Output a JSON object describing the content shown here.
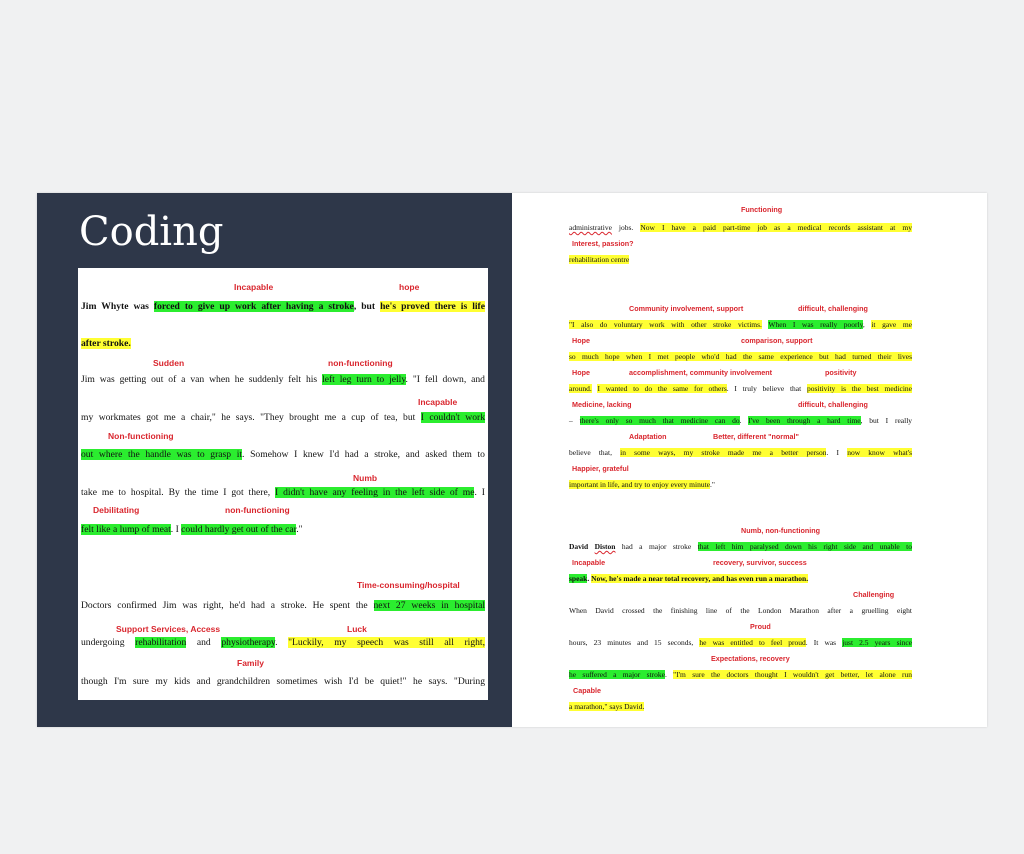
{
  "title": "Coding",
  "doc1": {
    "labels": [
      "Incapable",
      "hope",
      "Sudden",
      "non-functioning",
      "Incapable",
      "Non-functioning",
      "Numb",
      "Debilitating",
      "non-functioning",
      "Time-consuming/hospital",
      "Support Services, Access",
      "Luck",
      "Family"
    ],
    "seg": [
      "Jim Whyte was ",
      "forced to give up work after having a stroke",
      ", but ",
      "he's proved there is life",
      "after stroke.",
      "Jim was getting out of a van when he suddenly felt his ",
      "left leg turn to jelly",
      ". \"I fell down, and",
      "my workmates got me a chair,\" he says. \"They brought me a cup of tea, but ",
      "I couldn't work",
      "out where the handle was to grasp it",
      ". Somehow I knew I'd had a stroke, and asked them to",
      "take me to hospital. By the time I got there, ",
      "I didn't have any feeling in the left side of me",
      ". I",
      "felt like a lump of meat",
      ". I ",
      "could hardly get out of the car",
      ".\"",
      "Doctors confirmed Jim was right, he'd had a stroke. He spent the ",
      "next 27 weeks in hospital",
      "undergoing ",
      "rehabilitation",
      " and ",
      "physiotherapy",
      ". ",
      "\"Luckily, my speech was still all right,",
      "though I'm sure my kids and grandchildren sometimes wish I'd be quiet!\" he says. \"During"
    ]
  },
  "doc2": {
    "labels": [
      "Functioning",
      "Interest, passion?",
      "Community involvement, support",
      "difficult, challenging",
      "Hope",
      "comparison, support",
      "Hope",
      "accomplishment, community involvement",
      "positivity",
      "Medicine, lacking",
      "difficult, challenging",
      "Adaptation",
      "Better, different \"normal\"",
      "Happier, grateful",
      "Numb, non-functioning",
      "Incapable",
      "recovery, survivor, success",
      "Challenging",
      "Proud",
      "Expectations, recovery",
      "Capable"
    ],
    "seg": [
      "administrative",
      " jobs. ",
      "Now I have a paid part-time job as a medical records assistant at my",
      "rehabilitation centre",
      "\"I also do voluntary work with other stroke victims.",
      " ",
      "When I was really poorly",
      ", ",
      "it gave me",
      "so much hope when I met people who'd had the same experience but had turned their lives",
      "around.",
      " ",
      "I wanted to do the same for others",
      ". I truly believe that ",
      "positivity is the best medicine",
      "– ",
      "there's only so much that medicine can do",
      ". ",
      "I've been through a hard time",
      ", but I really",
      "believe that, ",
      "in some ways, my stroke made me a better person",
      ". I ",
      "now know what's",
      "important in life, and try to enjoy every minute",
      ".\"",
      "David ",
      "Diston",
      " had a major stroke ",
      "that left him paralysed down his right side and unable to",
      "speak",
      ". ",
      "Now, he's made a near total recovery, and has even run a marathon.",
      "When David crossed the finishing line of the London Marathon after a gruelling eight",
      "hours, 23 minutes and 15 seconds, ",
      "he was entitled to feel proud",
      ". It was ",
      "just 2.5 years since",
      "he suffered a major stroke",
      ". ",
      "\"I'm sure the doctors thought I wouldn't get better, let alone run",
      "a marathon,\" says David."
    ]
  }
}
